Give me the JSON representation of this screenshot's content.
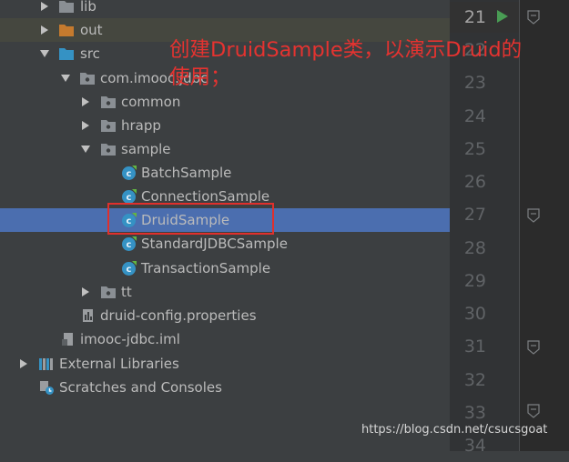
{
  "tree": {
    "rows": [
      {
        "label": "lib",
        "icon": "folder-icon",
        "arrow": "right"
      },
      {
        "label": "out",
        "icon": "excluded-folder-icon",
        "arrow": "right"
      },
      {
        "label": "src",
        "icon": "source-folder-icon",
        "arrow": "down"
      },
      {
        "label": "com.imooc.jdbc",
        "icon": "package-icon",
        "arrow": "down"
      },
      {
        "label": "common",
        "icon": "package-icon",
        "arrow": "right"
      },
      {
        "label": "hrapp",
        "icon": "package-icon",
        "arrow": "right"
      },
      {
        "label": "sample",
        "icon": "package-icon",
        "arrow": "down"
      },
      {
        "label": "BatchSample",
        "icon": "java-class-icon",
        "arrow": "none"
      },
      {
        "label": "ConnectionSample",
        "icon": "java-class-icon",
        "arrow": "none"
      },
      {
        "label": "DruidSample",
        "icon": "java-class-icon",
        "arrow": "none",
        "selected": true
      },
      {
        "label": "StandardJDBCSample",
        "icon": "java-class-icon",
        "arrow": "none"
      },
      {
        "label": "TransactionSample",
        "icon": "java-class-icon",
        "arrow": "none"
      },
      {
        "label": "tt",
        "icon": "package-icon",
        "arrow": "right"
      },
      {
        "label": "druid-config.properties",
        "icon": "properties-file-icon",
        "arrow": "none"
      },
      {
        "label": "imooc-jdbc.iml",
        "icon": "iml-file-icon",
        "arrow": "none"
      },
      {
        "label": "External Libraries",
        "icon": "external-libraries-icon",
        "arrow": "right"
      },
      {
        "label": "Scratches and Consoles",
        "icon": "scratches-icon",
        "arrow": "none"
      }
    ]
  },
  "gutter": {
    "line_numbers": [
      "21",
      "22",
      "23",
      "24",
      "25",
      "26",
      "27",
      "28",
      "29",
      "30",
      "31",
      "32",
      "33",
      "34"
    ],
    "current_line": "21"
  },
  "annotation": {
    "text": "创建DruidSample类，以演示Druid的使用；"
  },
  "watermark": {
    "text": "https://blog.csdn.net/csucsgoat"
  },
  "colors": {
    "panel_bg": "#3c3f41",
    "selection": "#4b6eaf",
    "annotation_red": "#e53330",
    "text": "#bbbbbb"
  }
}
